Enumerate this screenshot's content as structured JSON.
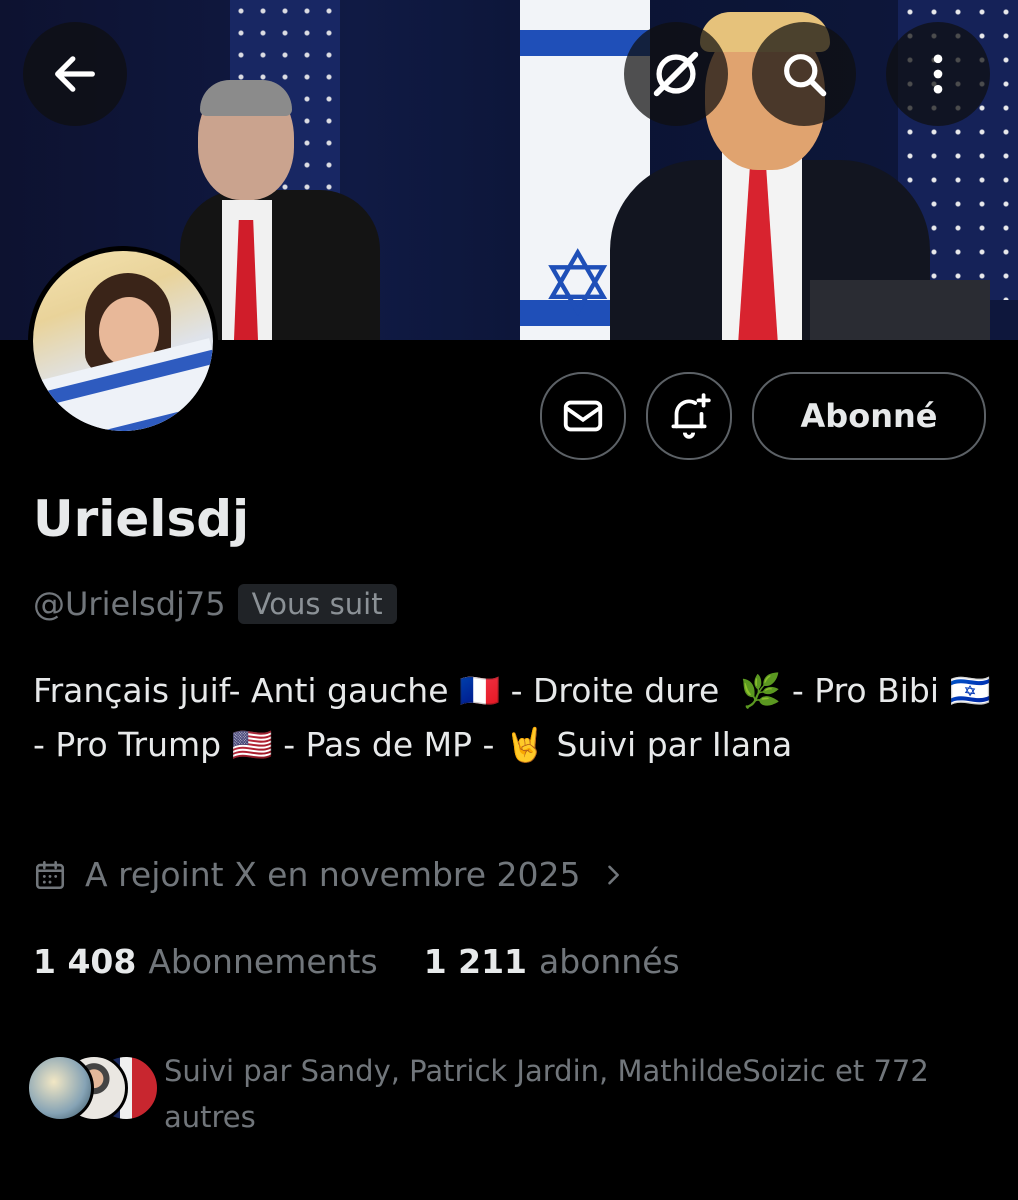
{
  "header": {
    "back_icon": "arrow-left-icon",
    "grok_icon": "grok-icon",
    "search_icon": "search-icon",
    "more_icon": "more-vertical-icon"
  },
  "profile": {
    "display_name": "Urielsdj",
    "handle": "@Urielsdj75",
    "follows_you_badge": "Vous suit",
    "bio": "Français juif- Anti gauche 🇫🇷 - Droite dure  🌿 - Pro Bibi 🇮🇱 - Pro Trump 🇺🇸 - Pas de MP - 🤘 Suivi par Ilana",
    "joined": "A rejoint X en novembre 2025"
  },
  "actions": {
    "message_icon": "envelope-icon",
    "notify_icon": "bell-plus-icon",
    "follow_label": "Abonné"
  },
  "stats": {
    "following_count": "1 408",
    "following_label": "Abonnements",
    "followers_count": "1 211",
    "followers_label": "abonnés"
  },
  "followed_by": {
    "text": "Suivi par Sandy, Patrick Jardin, MathildeSoizic et 772 autres"
  },
  "colors": {
    "background": "#000000",
    "primary_text": "#e7e9ea",
    "secondary_text": "#71767b",
    "border": "#5c6166"
  }
}
